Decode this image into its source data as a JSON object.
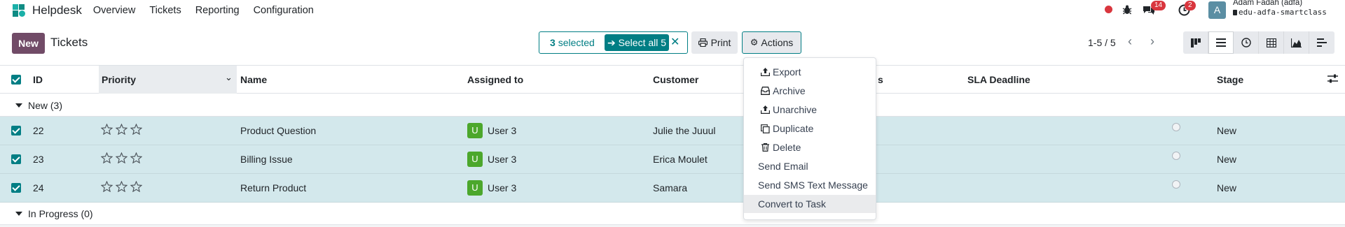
{
  "navbar": {
    "app_name": "Helpdesk",
    "menu": [
      "Overview",
      "Tickets",
      "Reporting",
      "Configuration"
    ],
    "chat_badge": "14",
    "activity_badge": "2",
    "user_initial": "A",
    "user_name": "Adam Fadah (adfa)",
    "user_db": "edu-adfa-smartclass"
  },
  "control_panel": {
    "new_label": "New",
    "title": "Tickets",
    "selected_count": "3",
    "selected_label": "selected",
    "select_all_label": "Select all 5",
    "print_label": "Print",
    "actions_label": "Actions",
    "pager": "1-5 / 5"
  },
  "table": {
    "columns": {
      "id": "ID",
      "priority": "Priority",
      "name": "Name",
      "assigned": "Assigned to",
      "customer": "Customer",
      "status_partial": "s",
      "sla": "SLA Deadline",
      "stage": "Stage"
    },
    "groups": [
      {
        "label": "New (3)"
      },
      {
        "label": "In Progress (0)"
      }
    ],
    "rows": [
      {
        "id": "22",
        "name": "Product Question",
        "user_initial": "U",
        "user": "User 3",
        "customer": "Julie the Juuul",
        "stage": "New"
      },
      {
        "id": "23",
        "name": "Billing Issue",
        "user_initial": "U",
        "user": "User 3",
        "customer": "Erica Moulet",
        "stage": "New"
      },
      {
        "id": "24",
        "name": "Return Product",
        "user_initial": "U",
        "user": "User 3",
        "customer": "Samara",
        "stage": "New"
      }
    ]
  },
  "actions_menu": {
    "items": [
      {
        "label": "Export",
        "icon": "upload-icon"
      },
      {
        "label": "Archive",
        "icon": "inbox-icon"
      },
      {
        "label": "Unarchive",
        "icon": "upload-icon"
      },
      {
        "label": "Duplicate",
        "icon": "copy-icon"
      },
      {
        "label": "Delete",
        "icon": "trash-icon"
      },
      {
        "label": "Send Email",
        "icon": ""
      },
      {
        "label": "Send SMS Text Message",
        "icon": ""
      },
      {
        "label": "Convert to Task",
        "icon": ""
      }
    ]
  },
  "colors": {
    "primary": "#714b67",
    "accent": "#017e84",
    "selected_row": "#d3e8ec",
    "user_avatar": "#4ca72c",
    "badge": "#d9363e"
  }
}
